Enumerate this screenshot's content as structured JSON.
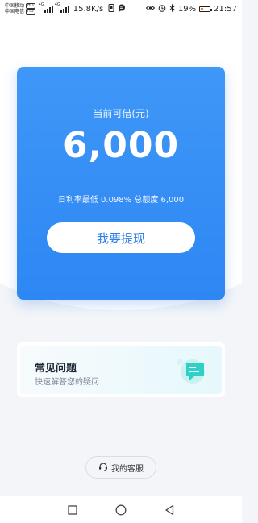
{
  "status_bar": {
    "carrier_1": "中国移动",
    "carrier_2": "中国电信",
    "hd_1": "HD",
    "hd_2": "HD",
    "net_gen_1": "4G",
    "net_gen_2": "4G",
    "net_speed": "15.8K/s",
    "battery": "19%",
    "time": "21:57"
  },
  "loan_card": {
    "label": "当前可借(元)",
    "amount": "6,000",
    "rate_text": "日利率最低 0.098% 总额度 6,000",
    "withdraw_button": "我要提现"
  },
  "faq": {
    "title": "常见问题",
    "subtitle": "快速解答您的疑问",
    "icon": "chat-bubble-icon"
  },
  "customer_service": {
    "label": "我的客服",
    "icon": "headset-icon"
  },
  "nav_bar": {
    "icons": [
      "square-recent-icon",
      "circle-home-icon",
      "triangle-back-icon"
    ]
  },
  "colors": {
    "card_blue": "#3391f5",
    "button_text": "#2e7fe8",
    "background": "#f3f5f8",
    "faq_accent": "#2fd0c8"
  }
}
